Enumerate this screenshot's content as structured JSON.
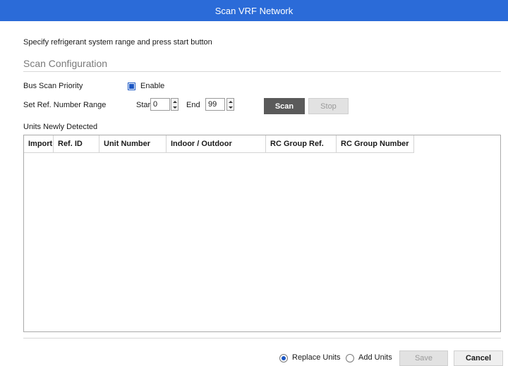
{
  "window": {
    "title": "Scan VRF Network"
  },
  "instruction": "Specify refrigerant system range and press start button",
  "section": {
    "title": "Scan Configuration"
  },
  "bus_scan": {
    "label": "Bus Scan Priority",
    "checkbox_label": "Enable",
    "checked": true
  },
  "range": {
    "label": "Set Ref. Number Range",
    "start_label": "Start",
    "start_value": "0",
    "end_label": "End",
    "end_value": "99"
  },
  "buttons": {
    "scan": "Scan",
    "stop": "Stop",
    "save": "Save",
    "cancel": "Cancel"
  },
  "units": {
    "label": "Units Newly Detected",
    "columns": [
      "Import",
      "Ref. ID",
      "Unit Number",
      "Indoor / Outdoor",
      "RC Group Ref.",
      "RC Group Number"
    ],
    "rows": []
  },
  "footer": {
    "replace_label": "Replace Units",
    "add_label": "Add Units",
    "selected": "replace"
  },
  "colors": {
    "titlebar": "#2b6bd8",
    "accent": "#1b57c4",
    "scan_button": "#5a5a5a"
  }
}
